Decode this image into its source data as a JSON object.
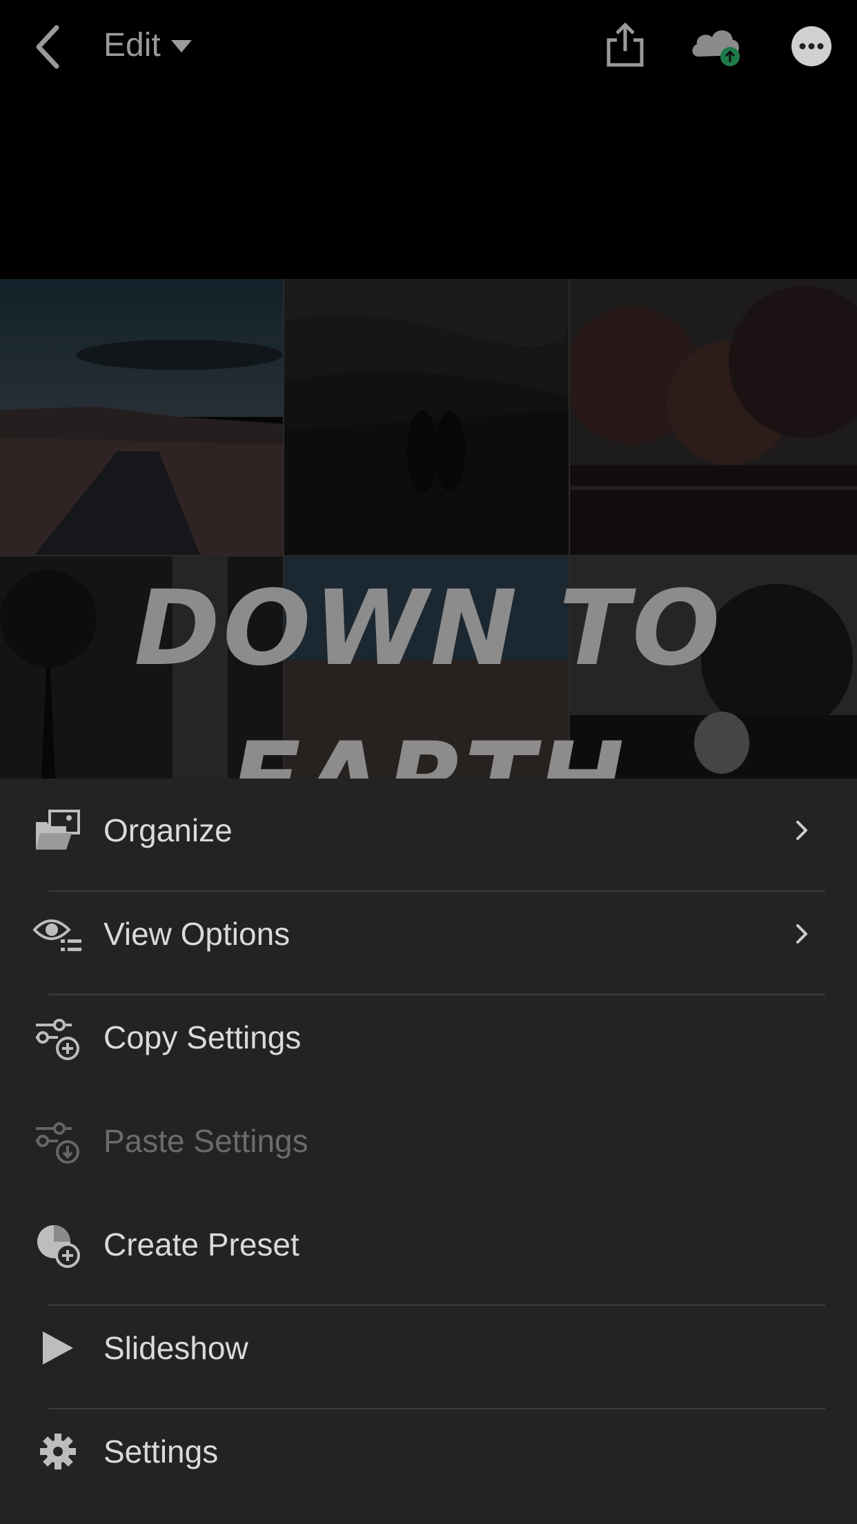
{
  "header": {
    "title": "Edit",
    "icons": [
      "back-icon",
      "caret-down-icon",
      "share-icon",
      "cloud-sync-icon",
      "more-icon"
    ],
    "cloud_badge_color": "#1f7a4a"
  },
  "photo_overlay": {
    "line1": "DOWN TO",
    "line2": "EARTH"
  },
  "menu": {
    "items": [
      {
        "label": "Organize",
        "icon": "organize-icon",
        "has_submenu": true,
        "enabled": true
      },
      {
        "label": "View Options",
        "icon": "view-options-icon",
        "has_submenu": true,
        "enabled": true
      },
      {
        "label": "Copy Settings",
        "icon": "copy-settings-icon",
        "has_submenu": false,
        "enabled": true
      },
      {
        "label": "Paste Settings",
        "icon": "paste-settings-icon",
        "has_submenu": false,
        "enabled": false
      },
      {
        "label": "Create Preset",
        "icon": "create-preset-icon",
        "has_submenu": false,
        "enabled": true
      },
      {
        "label": "Slideshow",
        "icon": "play-icon",
        "has_submenu": false,
        "enabled": true
      },
      {
        "label": "Settings",
        "icon": "gear-icon",
        "has_submenu": false,
        "enabled": true
      }
    ]
  },
  "colors": {
    "sheet_background": "#232323",
    "text": "#dadada",
    "disabled_text": "#6b6b6b",
    "background": "#000000"
  }
}
